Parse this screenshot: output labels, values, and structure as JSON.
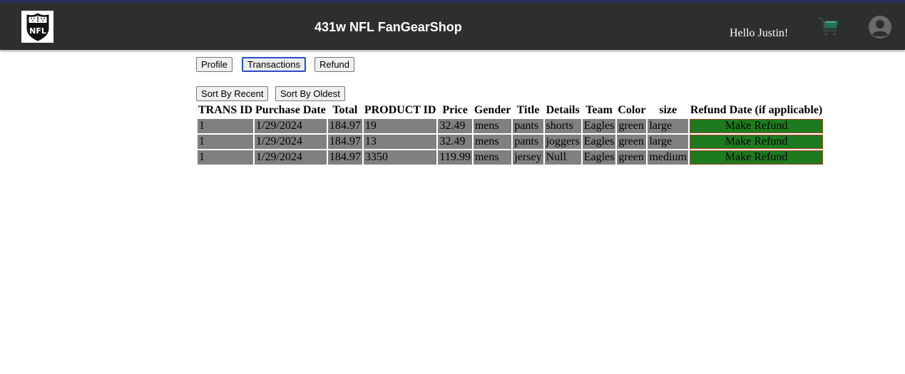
{
  "header": {
    "site_title": "431w NFL FanGearShop",
    "greeting": "Hello Justin!",
    "logo_icon": "nfl-shield-logo",
    "cart_icon": "shopping-cart-icon",
    "account_icon": "user-avatar-icon",
    "background_color": "#2e2e2e"
  },
  "nav": {
    "profile_label": "Profile",
    "transactions_label": "Transactions",
    "refund_label": "Refund",
    "active_tab": "Transactions"
  },
  "sort": {
    "recent_label": "Sort By Recent",
    "oldest_label": "Sort By Oldest"
  },
  "table": {
    "columns": [
      "TRANS ID",
      "Purchase Date",
      "Total",
      "PRODUCT ID",
      "Price",
      "Gender",
      "Title",
      "Details",
      "Team",
      "Color",
      "size",
      "Refund Date (if applicable)"
    ],
    "rows": [
      {
        "trans_id": "1",
        "purchase_date": "1/29/2024",
        "total": "184.97",
        "product_id": "19",
        "price": "32.49",
        "gender": "mens",
        "title": "pants",
        "details": "shorts",
        "team": "Eagles",
        "color": "green",
        "size": "large",
        "refund": "Make Refund"
      },
      {
        "trans_id": "1",
        "purchase_date": "1/29/2024",
        "total": "184.97",
        "product_id": "13",
        "price": "32.49",
        "gender": "mens",
        "title": "pants",
        "details": "joggers",
        "team": "Eagles",
        "color": "green",
        "size": "large",
        "refund": "Make Refund"
      },
      {
        "trans_id": "1",
        "purchase_date": "1/29/2024",
        "total": "184.97",
        "product_id": "3350",
        "price": "119.99",
        "gender": "mens",
        "title": "jersey",
        "details": "Null",
        "team": "Eagles",
        "color": "green",
        "size": "medium",
        "refund": "Make Refund"
      }
    ],
    "cell_color": "#808080",
    "refund_button_color": "#1e7a1e"
  }
}
